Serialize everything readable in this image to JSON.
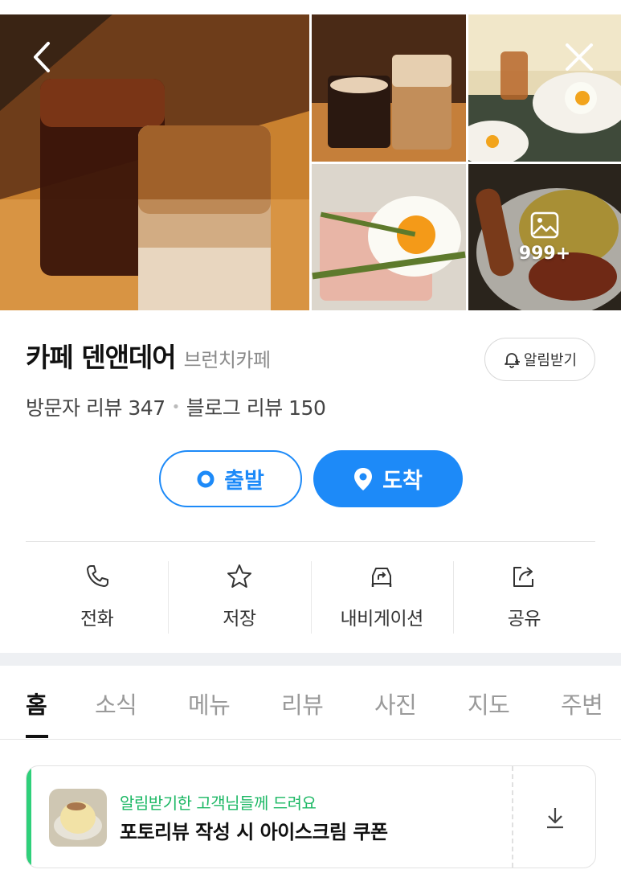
{
  "gallery": {
    "photo_count": "999+",
    "photos": [
      "iced-coffees-photo",
      "latte-drinks-photo",
      "brunch-plate-photo",
      "egg-toast-photo",
      "omelette-rice-photo"
    ]
  },
  "place": {
    "name": "카페 덴앤데어",
    "category": "브런치카페",
    "notify_label": "알림받기",
    "visitor_reviews": "방문자 리뷰 347",
    "blog_reviews": "블로그 리뷰 150"
  },
  "route": {
    "start_label": "출발",
    "end_label": "도착"
  },
  "actions": [
    {
      "label": "전화",
      "icon": "phone-icon"
    },
    {
      "label": "저장",
      "icon": "star-icon"
    },
    {
      "label": "내비게이션",
      "icon": "navigation-car-icon"
    },
    {
      "label": "공유",
      "icon": "share-icon"
    }
  ],
  "tabs": [
    "홈",
    "소식",
    "메뉴",
    "리뷰",
    "사진",
    "지도",
    "주변"
  ],
  "active_tab": "홈",
  "coupon": {
    "subtitle": "알림받기한 고객님들께 드려요",
    "title": "포토리뷰 작성 시 아이스크림 쿠폰"
  },
  "colors": {
    "accent_blue": "#1d8af8",
    "coupon_green": "#2ed07a"
  }
}
